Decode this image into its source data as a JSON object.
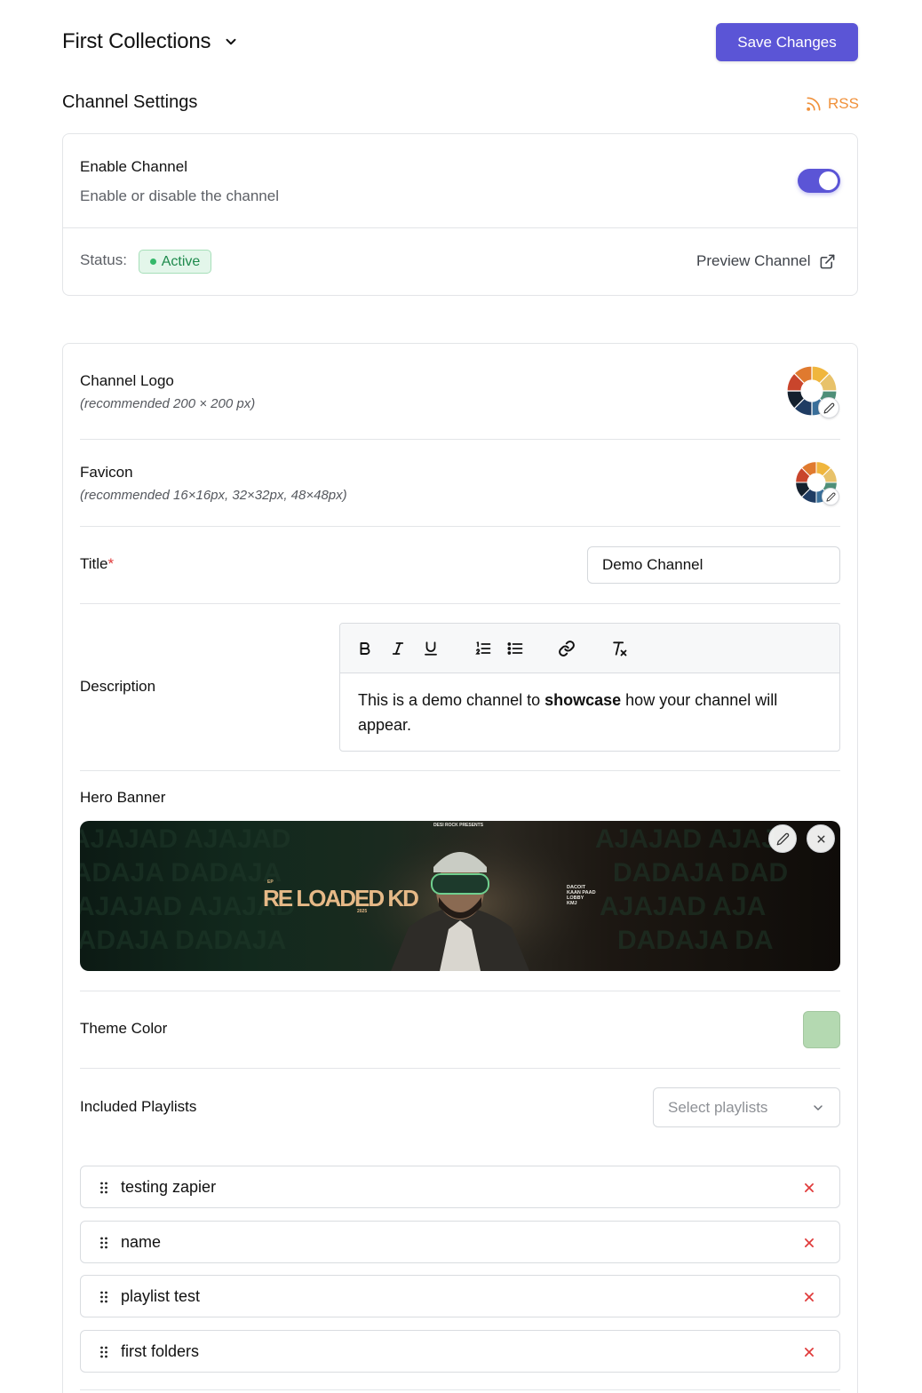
{
  "header": {
    "collection_title": "First Collections",
    "save_label": "Save Changes"
  },
  "channel_settings": {
    "title": "Channel Settings",
    "rss_label": "RSS",
    "enable_label": "Enable Channel",
    "enable_description": "Enable or disable the channel",
    "enabled": true,
    "status_label": "Status:",
    "status_value": "Active",
    "preview_label": "Preview Channel"
  },
  "form": {
    "logo_label": "Channel Logo",
    "logo_hint": "(recommended 200 × 200 px)",
    "favicon_label": "Favicon",
    "favicon_hint": "(recommended 16×16px, 32×32px, 48×48px)",
    "title_label": "Title",
    "title_required_mark": "*",
    "title_value": "Demo Channel",
    "description_label": "Description",
    "description_before": "This is a demo channel to ",
    "description_bold": "showcase",
    "description_after": " how your channel will appear.",
    "hero_banner_label": "Hero Banner",
    "banner_text": {
      "presents": "DESI ROCK PRESENTS",
      "title": "RE LOADED KD",
      "ep": "EP",
      "year": "2025",
      "tracks": [
        "DACOIT",
        "KAAN PAAD",
        "LOBBY",
        "KMJ"
      ]
    },
    "theme_color_label": "Theme Color",
    "theme_color": "#b4d9b1",
    "playlists_label": "Included Playlists",
    "playlists_placeholder": "Select playlists",
    "playlists": [
      {
        "name": "testing zapier"
      },
      {
        "name": "name"
      },
      {
        "name": "playlist test"
      },
      {
        "name": "first folders"
      }
    ]
  },
  "colors": {
    "accent": "#5b55d6",
    "rss": "#f0913b",
    "status_green": "#1e8a4c",
    "remove_red": "#e03b3b"
  },
  "icons": {
    "collection_chevron": "chevron-down-icon",
    "rss": "rss-icon",
    "preview": "external-link-icon",
    "edit": "pencil-icon",
    "close": "close-icon",
    "drag": "drag-handle-icon",
    "remove": "x-icon"
  }
}
